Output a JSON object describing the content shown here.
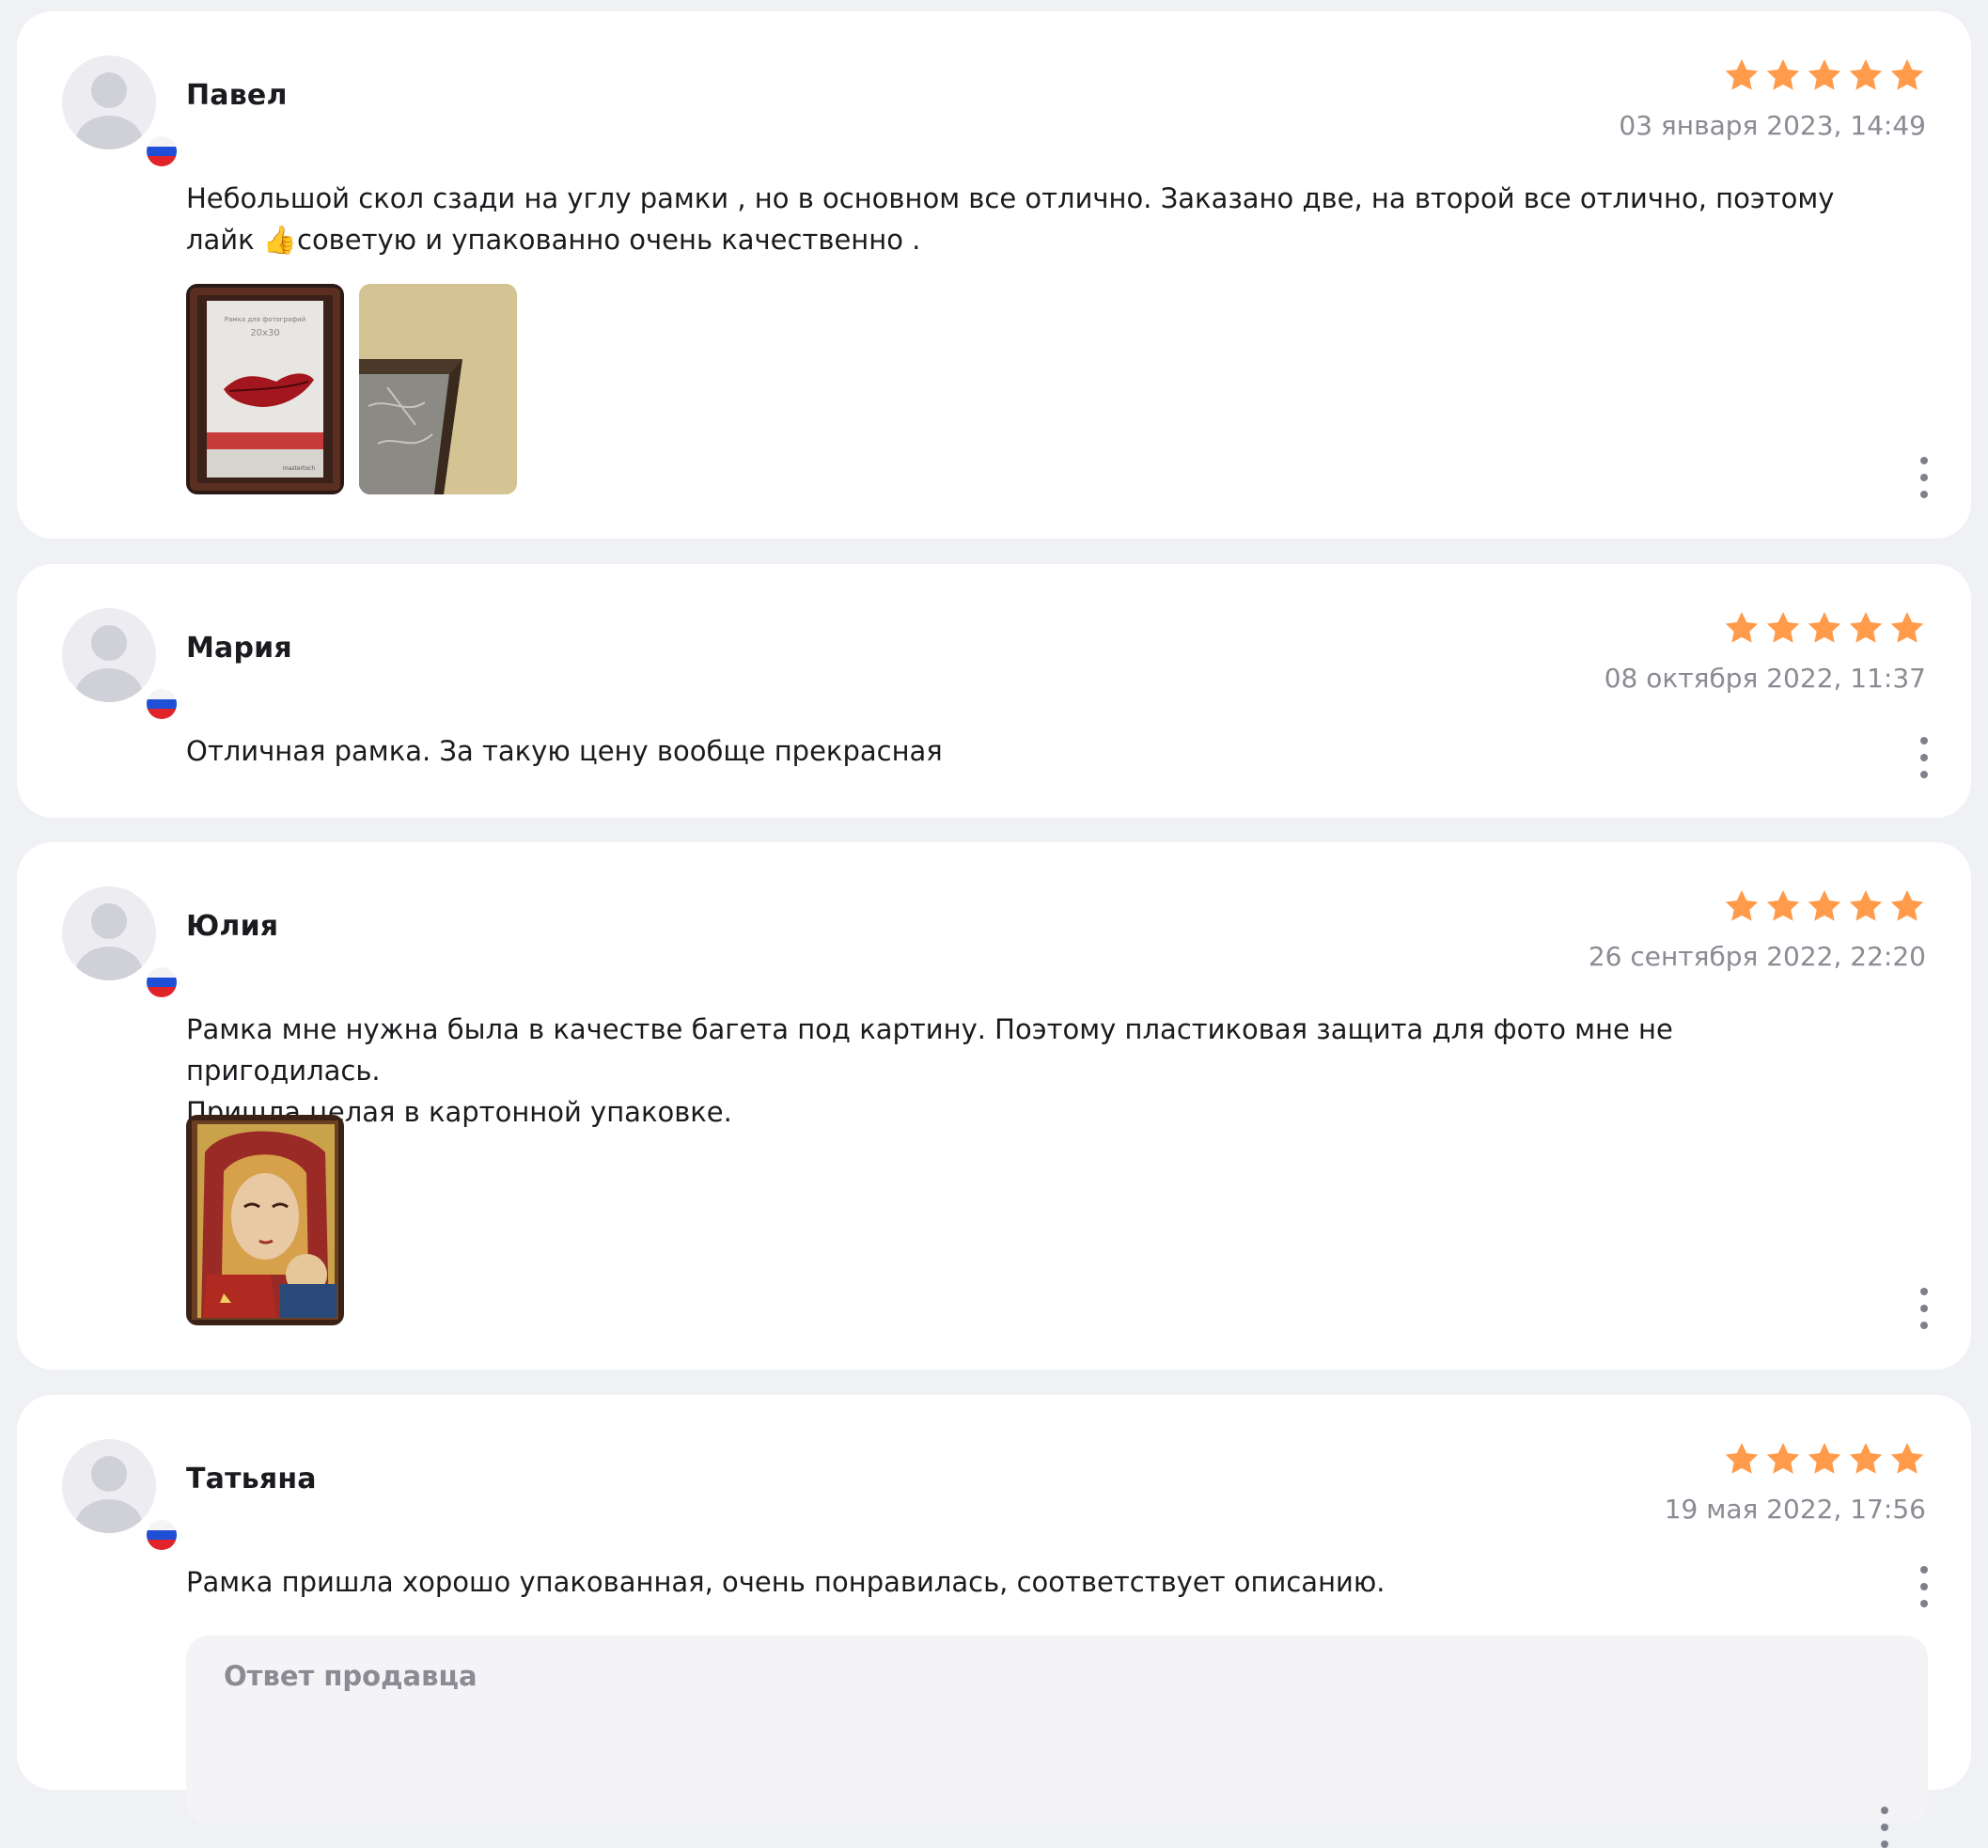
{
  "colors": {
    "page_bg": "#f0f1f5",
    "card_bg": "#ffffff",
    "star": "#ff9b4a",
    "date_text": "#8a8b93",
    "seller_bg": "#f4f4f7"
  },
  "icons": {
    "avatar": "user-placeholder-icon",
    "flag": "russia-flag-icon",
    "star": "star-icon",
    "menu": "more-vertical-icon"
  },
  "reviews": [
    {
      "author": "Павел",
      "rating": 5,
      "date": "03 января 2023, 14:49",
      "text_line1": "Небольшой скол сзади на углу рамки , но в основном все отлично. Заказано две, на второй все отлично, поэтому",
      "text_line2_prefix": "лайк ",
      "emoji": "👍",
      "text_line2_suffix": "советую и упакованно очень качественно .",
      "photo_count": 2,
      "photo_frame_caption": "Рамка для фотографий",
      "photo_frame_size": "20x30",
      "photo_frame_brand": "mastertoch"
    },
    {
      "author": "Мария",
      "rating": 5,
      "date": "08 октября 2022, 11:37",
      "text": "Отличная рамка. За такую цену вообще прекрасная",
      "photo_count": 0
    },
    {
      "author": "Юлия",
      "rating": 5,
      "date": "26 сентября 2022, 22:20",
      "text_line1": "Рамка мне нужна была в качестве багета под картину. Поэтому пластиковая защита для фото мне не пригодилась.",
      "text_line2": "Пришла целая в картонной упаковке.",
      "photo_count": 1
    },
    {
      "author": "Татьяна",
      "rating": 5,
      "date": "19 мая 2022, 17:56",
      "text": "Рамка пришла хорошо упакованная, очень понравилась, соответствует описанию.",
      "photo_count": 0,
      "seller_reply_title": "Ответ продавца"
    }
  ]
}
